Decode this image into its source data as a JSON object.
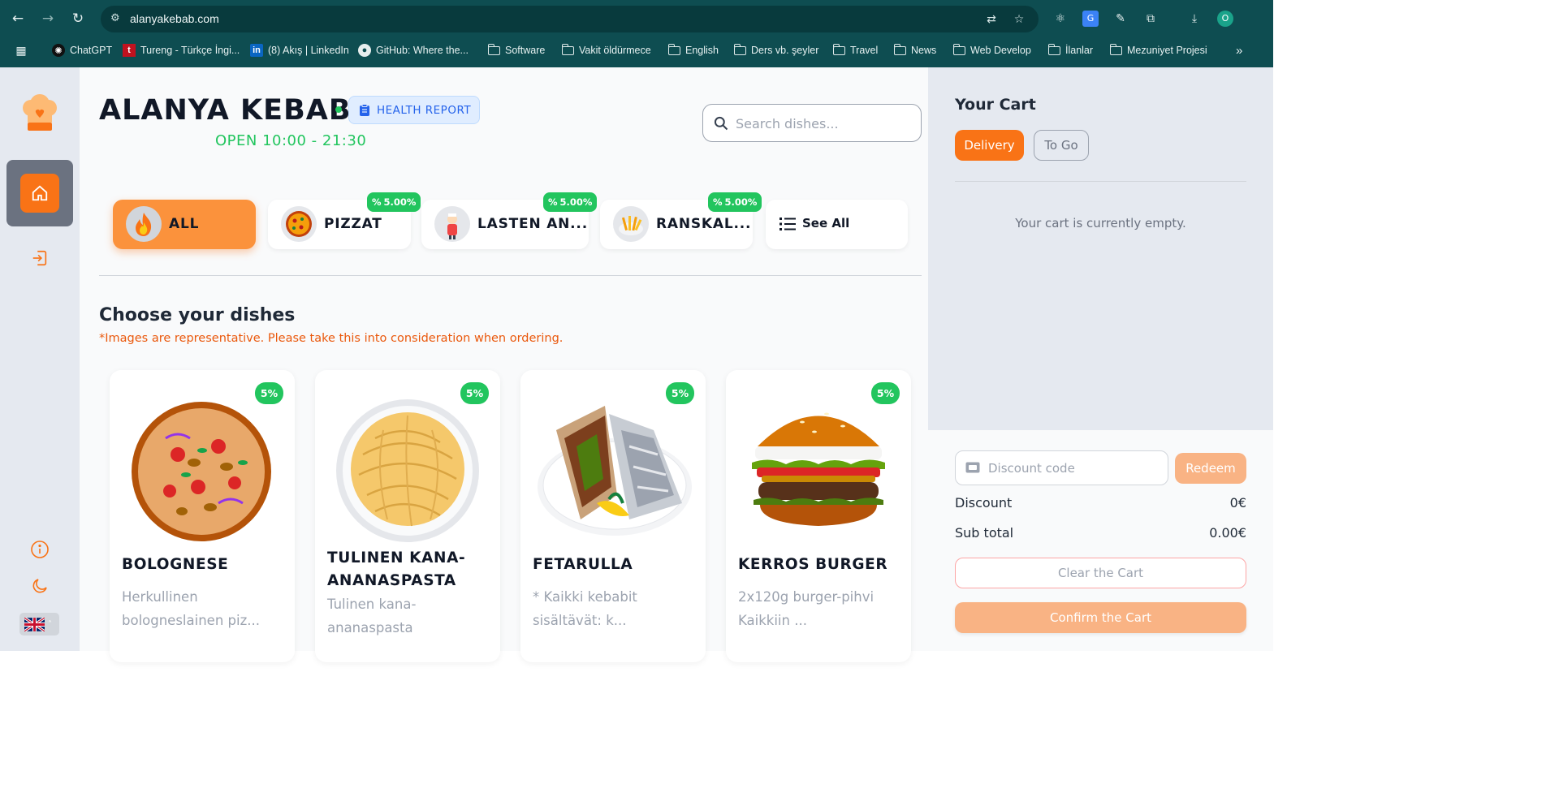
{
  "browser": {
    "url": "alanyakebab.com",
    "profile_initial": "O",
    "bookmarks": [
      {
        "label": "ChatGPT",
        "icon": "chatgpt-icon"
      },
      {
        "label": "Tureng - Türkçe İngi...",
        "icon": "tureng-icon"
      },
      {
        "label": "(8) Akış | LinkedIn",
        "icon": "linkedin-icon"
      },
      {
        "label": "GitHub: Where the...",
        "icon": "github-icon"
      },
      {
        "label": "Software",
        "icon": "folder-icon"
      },
      {
        "label": "Vakit öldürmece",
        "icon": "folder-icon"
      },
      {
        "label": "English",
        "icon": "folder-icon"
      },
      {
        "label": "Ders vb. şeyler",
        "icon": "folder-icon"
      },
      {
        "label": "Travel",
        "icon": "folder-icon"
      },
      {
        "label": "News",
        "icon": "folder-icon"
      },
      {
        "label": "Web Develop",
        "icon": "folder-icon"
      },
      {
        "label": "İlanlar",
        "icon": "folder-icon"
      },
      {
        "label": "Mezuniyet Projesi",
        "icon": "folder-icon"
      }
    ]
  },
  "restaurant": {
    "name": "ALANYA KEBAB",
    "health_report": "HEALTH REPORT",
    "hours": "OPEN 10:00 - 21:30"
  },
  "search": {
    "placeholder": "Search dishes..."
  },
  "categories": [
    {
      "label": "ALL",
      "active": true
    },
    {
      "label": "PIZZAT",
      "discount": "5.00%"
    },
    {
      "label": "LASTEN AN...",
      "discount": "5.00%"
    },
    {
      "label": "RANSKAL...",
      "discount": "5.00%"
    },
    {
      "label": "See All"
    }
  ],
  "dishes_section": {
    "title": "Choose your dishes",
    "disclaimer": "*Images are representative. Please take this into consideration when ordering."
  },
  "dishes": [
    {
      "name": "BOLOGNESE",
      "desc_lines": [
        "Herkullinen",
        "bologneslainen piz..."
      ],
      "discount": "5%"
    },
    {
      "name_lines": [
        "TULINEN KANA-",
        "ANANASPASTA"
      ],
      "desc_lines": [
        "Tulinen kana-",
        "ananaspasta"
      ],
      "discount": "5%"
    },
    {
      "name": "FETARULLA",
      "desc_lines": [
        "* Kaikki kebabit",
        "sisältävät: k..."
      ],
      "discount": "5%"
    },
    {
      "name": "KERROS BURGER",
      "desc_lines": [
        "2x120g burger-pihvi",
        "Kaikkiin ..."
      ],
      "discount": "5%"
    }
  ],
  "cart": {
    "title": "Your Cart",
    "tab_delivery": "Delivery",
    "tab_togo": "To Go",
    "empty_message": "Your cart is currently empty.",
    "discount_placeholder": "Discount code",
    "redeem": "Redeem",
    "discount_label": "Discount",
    "discount_value": "0€",
    "subtotal_label": "Sub total",
    "subtotal_value": "0.00€",
    "clear": "Clear the Cart",
    "confirm": "Confirm the Cart"
  },
  "colors": {
    "accent": "#f97316",
    "success": "#22c55e",
    "browser": "#0e4d51"
  }
}
